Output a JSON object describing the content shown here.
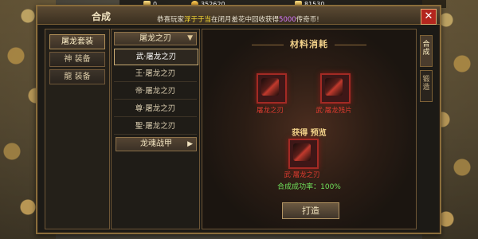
{
  "resources": [
    {
      "icon": "ingot-icon",
      "value": "0"
    },
    {
      "icon": "gold-coin-icon",
      "value": "352620"
    },
    {
      "icon": "yuanbao-icon",
      "value": "81530"
    }
  ],
  "window": {
    "title": "合成",
    "close_label": "✕"
  },
  "ticker": {
    "prefix": "恭喜玩家",
    "player": "浮于于当",
    "middle": "在闭月羞花中回收获得",
    "amount": "5000",
    "suffix": "传奇币!"
  },
  "categories": [
    {
      "label": "屠龙套装",
      "active": true
    },
    {
      "label": "神 装备",
      "active": false
    },
    {
      "label": "龍 装备",
      "active": false
    }
  ],
  "item_list": {
    "header": "屠龙之刃",
    "items": [
      {
        "label": "武·屠龙之刃",
        "selected": true
      },
      {
        "label": "王·屠龙之刃",
        "selected": false
      },
      {
        "label": "帝·屠龙之刃",
        "selected": false
      },
      {
        "label": "尊·屠龙之刃",
        "selected": false
      },
      {
        "label": "聖·屠龙之刃",
        "selected": false
      }
    ],
    "sub_button": "龙魂战甲"
  },
  "craft": {
    "materials_title": "材料消耗",
    "material_1": "屠龙之刃",
    "material_2": "武·屠龙残片",
    "obtain_label": "获得 预览",
    "result_name": "武·屠龙之刃",
    "success_rate": "合成成功率：100%",
    "forge_button": "打造"
  },
  "side_tabs": [
    {
      "label": "合成",
      "active": true
    },
    {
      "label": "锻造",
      "active": false
    }
  ],
  "colors": {
    "accent_gold": "#f3d28a",
    "material_red": "#e03b2f",
    "success_green": "#6fe05a",
    "close_red": "#b3261e"
  }
}
